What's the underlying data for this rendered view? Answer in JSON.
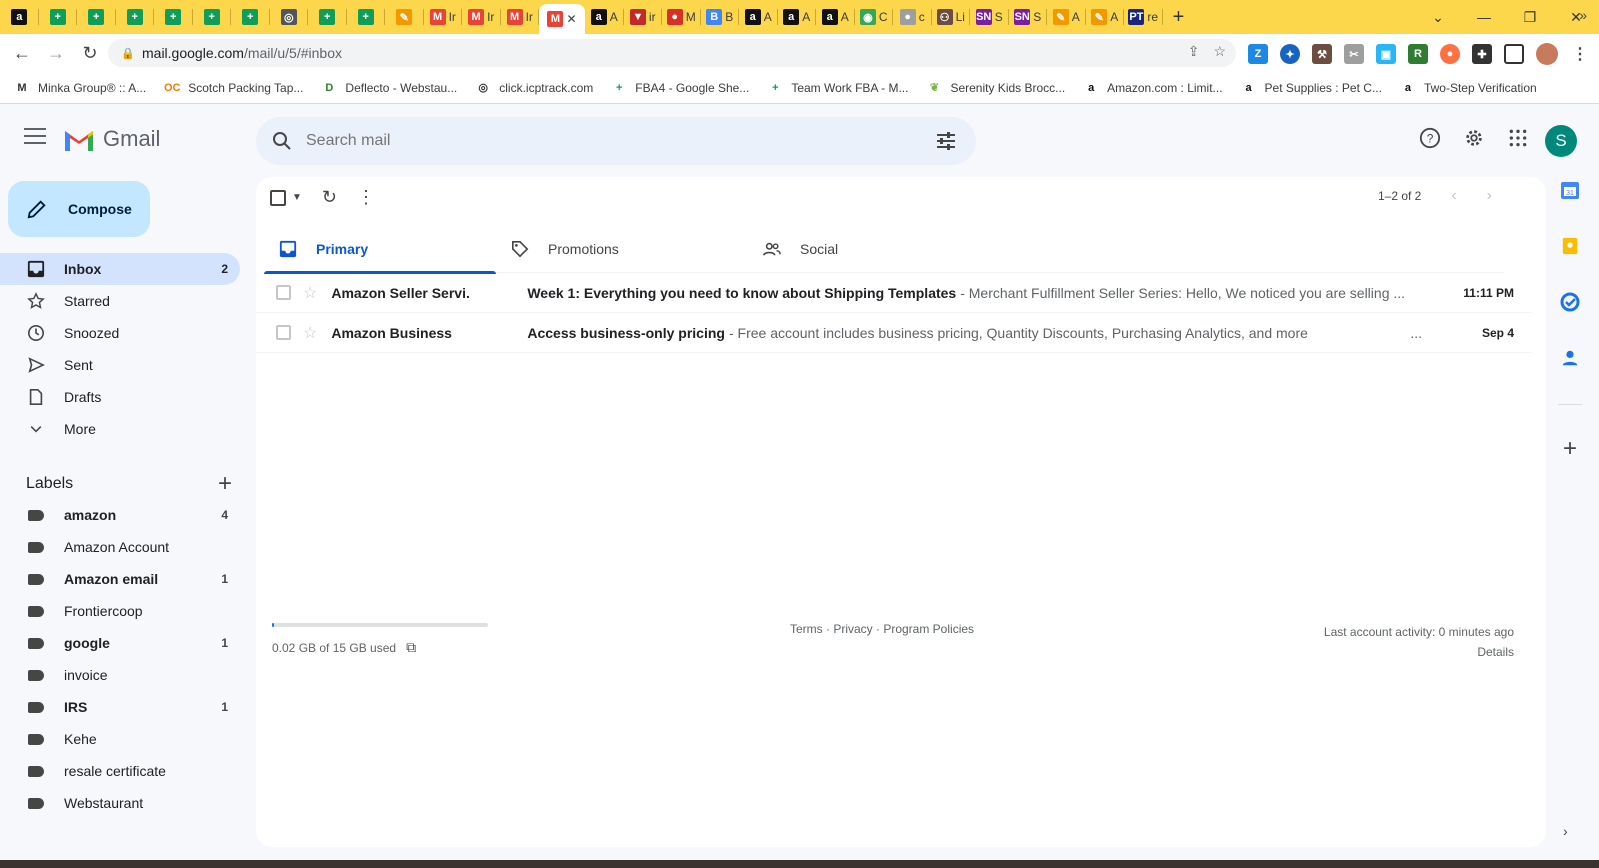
{
  "browser": {
    "tabs": [
      {
        "icon": "amazon-icon",
        "label": "",
        "color": "#111111"
      },
      {
        "icon": "sheets-icon",
        "label": "",
        "color": "#0f9d58"
      },
      {
        "icon": "sheets-icon",
        "label": "",
        "color": "#0f9d58"
      },
      {
        "icon": "sheets-icon",
        "label": "",
        "color": "#0f9d58"
      },
      {
        "icon": "sheets-icon",
        "label": "",
        "color": "#0f9d58"
      },
      {
        "icon": "sheets-icon",
        "label": "",
        "color": "#0f9d58"
      },
      {
        "icon": "sheets-icon",
        "label": "",
        "color": "#0f9d58"
      },
      {
        "icon": "globe-icon",
        "label": "",
        "color": "#555555"
      },
      {
        "icon": "sheets-icon",
        "label": "",
        "color": "#0f9d58"
      },
      {
        "icon": "sheets-icon",
        "label": "",
        "color": "#0f9d58"
      },
      {
        "icon": "pencil-icon",
        "label": "",
        "color": "#f29900"
      },
      {
        "icon": "gmail-icon",
        "label": "Ir",
        "color": "#ea4335"
      },
      {
        "icon": "gmail-icon",
        "label": "Ir",
        "color": "#ea4335"
      },
      {
        "icon": "gmail-icon",
        "label": "Ir",
        "color": "#ea4335"
      },
      {
        "icon": "gmail-icon",
        "label": "",
        "color": "#ea4335",
        "active": true
      },
      {
        "icon": "amazon-icon",
        "label": "A",
        "color": "#111111"
      },
      {
        "icon": "flag-icon",
        "label": "ir",
        "color": "#c62828"
      },
      {
        "icon": "pin-icon",
        "label": "M",
        "color": "#d93025"
      },
      {
        "icon": "doc-icon",
        "label": "B",
        "color": "#4285f4"
      },
      {
        "icon": "amazon-icon",
        "label": "A",
        "color": "#111111"
      },
      {
        "icon": "amazon-icon",
        "label": "A",
        "color": "#111111"
      },
      {
        "icon": "amazon-icon",
        "label": "A",
        "color": "#111111"
      },
      {
        "icon": "chrome-icon",
        "label": "C",
        "color": "#34a853"
      },
      {
        "icon": "circle-icon",
        "label": "c",
        "color": "#9e9e9e"
      },
      {
        "icon": "group-icon",
        "label": "Li",
        "color": "#6d4c41"
      },
      {
        "icon": "sn-icon",
        "label": "S",
        "color": "#7b1fa2"
      },
      {
        "icon": "sn-icon",
        "label": "S",
        "color": "#7b1fa2"
      },
      {
        "icon": "pencil-icon",
        "label": "A",
        "color": "#f29900"
      },
      {
        "icon": "pencil-icon",
        "label": "A",
        "color": "#f29900"
      },
      {
        "icon": "pt-icon",
        "label": "re",
        "color": "#1a237e"
      }
    ],
    "url_host": "mail.google.com",
    "url_path": "/mail/u/5/#inbox",
    "bookmarks": [
      {
        "icon": "minka-icon",
        "label": "Minka Group® :: A...",
        "color": "#333333"
      },
      {
        "icon": "oc-icon",
        "label": "Scotch Packing Tap...",
        "color": "#f57c00"
      },
      {
        "icon": "deflecto-icon",
        "label": "Deflecto - Webstau...",
        "color": "#2e7d32"
      },
      {
        "icon": "globe-icon",
        "label": "click.icptrack.com",
        "color": "#333333"
      },
      {
        "icon": "sheets-icon",
        "label": "FBA4 - Google She...",
        "color": "#0f9d58"
      },
      {
        "icon": "sheets-icon",
        "label": "Team Work FBA - M...",
        "color": "#0f9d58"
      },
      {
        "icon": "leaf-icon",
        "label": "Serenity Kids Brocc...",
        "color": "#7cb342"
      },
      {
        "icon": "amazon-icon",
        "label": "Amazon.com : Limit...",
        "color": "#111111"
      },
      {
        "icon": "amazon-icon",
        "label": "Pet Supplies : Pet C...",
        "color": "#111111"
      },
      {
        "icon": "amazon-icon",
        "label": "Two-Step Verification",
        "color": "#111111"
      }
    ]
  },
  "gmail": {
    "brand": "Gmail",
    "search_placeholder": "Search mail",
    "account_initial": "S",
    "compose_label": "Compose",
    "nav": [
      {
        "icon": "inbox-icon",
        "label": "Inbox",
        "count": "2",
        "active": true
      },
      {
        "icon": "star-icon",
        "label": "Starred",
        "count": ""
      },
      {
        "icon": "clock-icon",
        "label": "Snoozed",
        "count": ""
      },
      {
        "icon": "send-icon",
        "label": "Sent",
        "count": ""
      },
      {
        "icon": "draft-icon",
        "label": "Drafts",
        "count": ""
      },
      {
        "icon": "chevron-down-icon",
        "label": "More",
        "count": ""
      }
    ],
    "labels_title": "Labels",
    "labels": [
      {
        "label": "amazon",
        "count": "4",
        "bold": true
      },
      {
        "label": "Amazon Account",
        "count": "",
        "bold": false
      },
      {
        "label": "Amazon email",
        "count": "1",
        "bold": true
      },
      {
        "label": "Frontiercoop",
        "count": "",
        "bold": false
      },
      {
        "label": "google",
        "count": "1",
        "bold": true
      },
      {
        "label": "invoice",
        "count": "",
        "bold": false
      },
      {
        "label": "IRS",
        "count": "1",
        "bold": true
      },
      {
        "label": "Kehe",
        "count": "",
        "bold": false
      },
      {
        "label": "resale certificate",
        "count": "",
        "bold": false
      },
      {
        "label": "Webstaurant",
        "count": "",
        "bold": false
      }
    ],
    "paging": "1–2 of 2",
    "tabs": [
      {
        "icon": "inbox-icon",
        "label": "Primary",
        "active": true
      },
      {
        "icon": "tag-icon",
        "label": "Promotions",
        "active": false
      },
      {
        "icon": "people-icon",
        "label": "Social",
        "active": false
      }
    ],
    "emails": [
      {
        "sender": "Amazon Seller Servi.",
        "subject": "Week 1: Everything you need to know about Shipping Templates",
        "snippet": "- Merchant Fulfillment Seller Series: Hello, We noticed you are selling ...",
        "date": "11:11 PM",
        "dots": ""
      },
      {
        "sender": "Amazon Business",
        "subject": "Access business-only pricing",
        "snippet": "- Free account includes business pricing, Quantity Discounts, Purchasing Analytics, and more",
        "date": "Sep 4",
        "dots": "..."
      }
    ],
    "storage": {
      "text": "0.02 GB of 15 GB used",
      "fraction": 0.0013
    },
    "footer_links": "Terms · Privacy · Program Policies",
    "last_activity": "Last account activity: 0 minutes ago",
    "details": "Details"
  },
  "colors": {
    "tabstrip": "#fcd64b",
    "compose": "#c2e7ff",
    "active_nav": "#d3e3fd",
    "accent": "#0b57d0"
  }
}
